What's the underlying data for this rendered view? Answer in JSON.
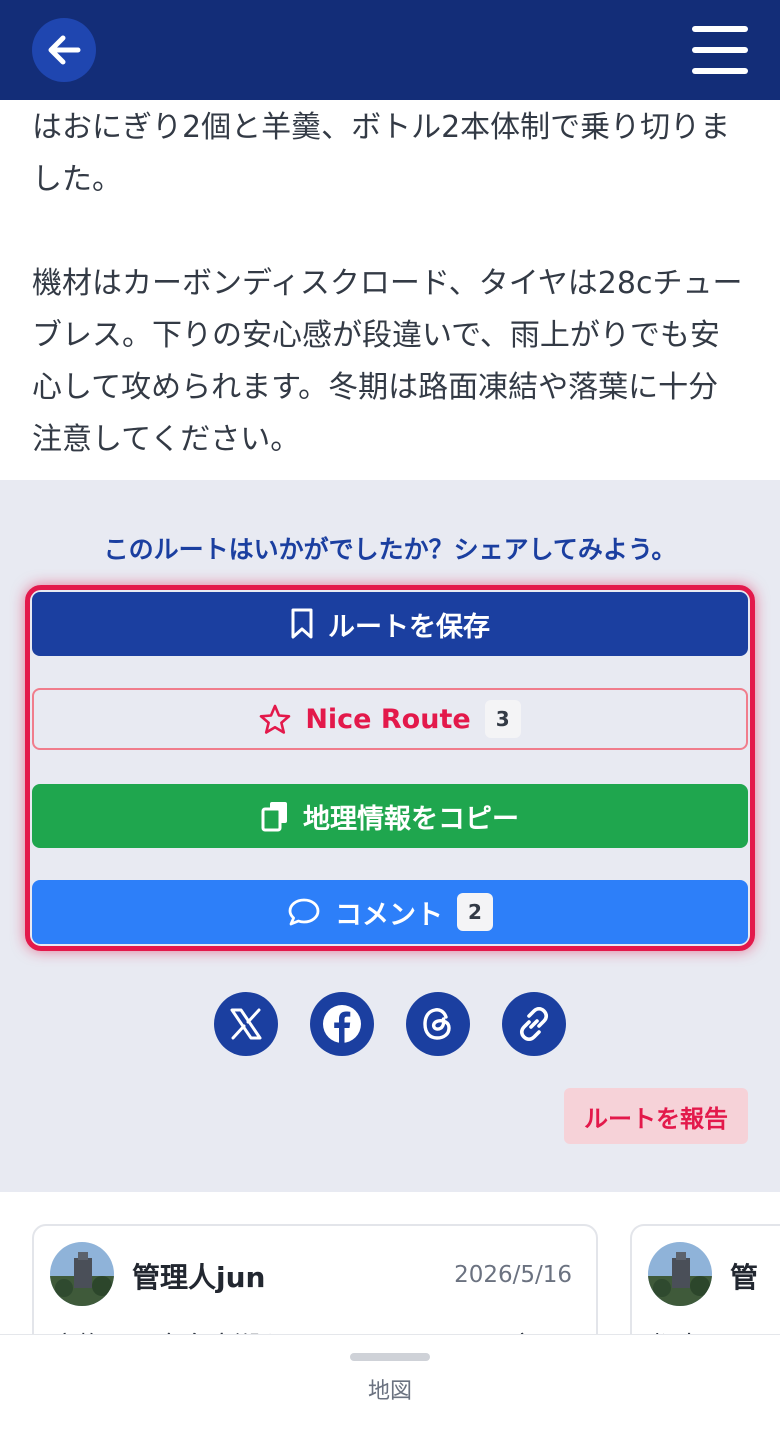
{
  "header": {
    "back_icon": "arrow-left-icon",
    "menu_icon": "hamburger-menu-icon"
  },
  "article": {
    "paragraph1": "はおにぎり2個と羊羹、ボトル2本体制で乗り切りました。",
    "paragraph2": "機材はカーボンディスクロード、タイヤは28cチューブレス。下りの安心感が段違いで、雨上がりでも安心して攻められます。冬期は路面凍結や落葉に十分注意してください。"
  },
  "share": {
    "prompt": "このルートはいかがでしたか？シェアしてみよう。",
    "save_label": "ルートを保存",
    "nice_label": "Nice Route",
    "nice_count": "3",
    "copy_label": "地理情報をコピー",
    "comment_label": "コメント",
    "comment_count": "2",
    "social_icons": [
      "x-icon",
      "facebook-icon",
      "threads-icon",
      "link-icon"
    ],
    "report_label": "ルートを報告"
  },
  "comments": [
    {
      "author": "管理人jun",
      "date": "2026/5/16",
      "snippet": "高梅から奥多摩湖をイス ロール 回れる空"
    },
    {
      "author": "管",
      "snippet": "都大回"
    }
  ],
  "bottom_bar": {
    "label": "地図"
  },
  "colors": {
    "header": "#132d78",
    "primary": "#1b3fa0",
    "accent_red": "#e3194b",
    "green": "#1fa64e",
    "blue": "#2d7ff9",
    "section_bg": "#e8eaf2"
  }
}
